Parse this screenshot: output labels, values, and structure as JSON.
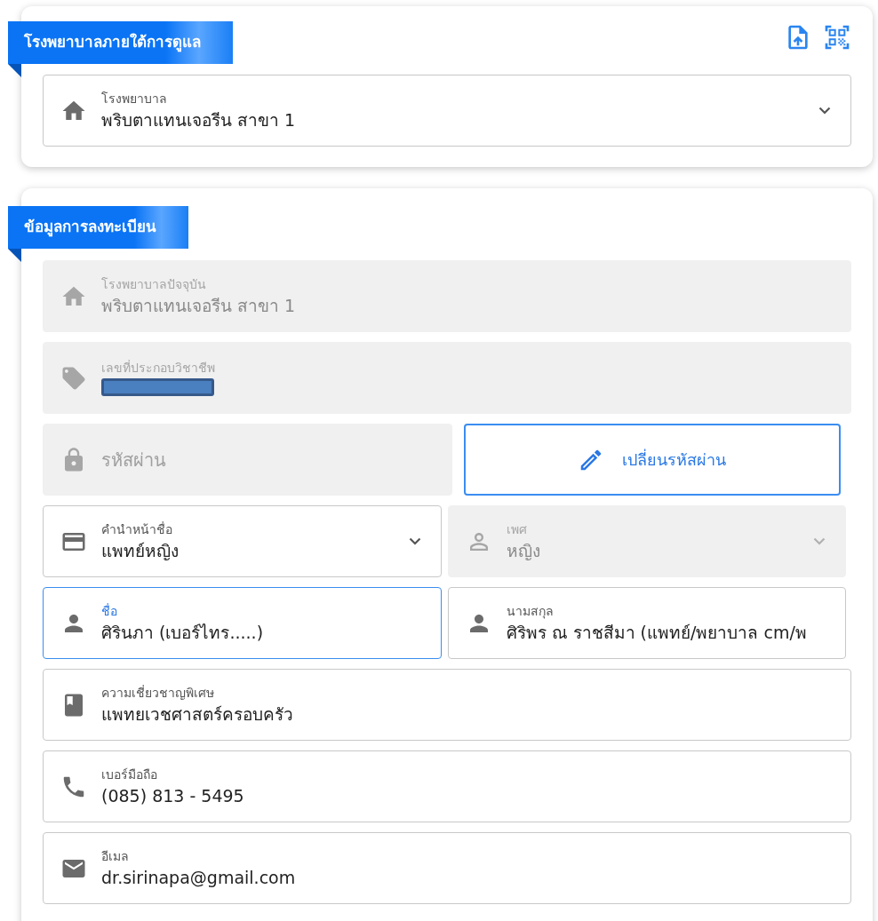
{
  "hospital_card": {
    "title": "โรงพยาบาลภายใต้การดูแล",
    "field": {
      "kind": "field",
      "label": "โรงพยาบาล",
      "value": "พริบตาแทนเจอรีน สาขา 1",
      "disabled": false,
      "focused": false,
      "dropdown": true
    }
  },
  "registration_card": {
    "title": "ข้อมูลการลงทะเบียน",
    "rows": [
      [
        {
          "kind": "field",
          "label": "โรงพยาบาลปัจจุบัน",
          "value": "พริบตาแทนเจอรีน สาขา 1",
          "disabled": true,
          "focused": false,
          "dropdown": false
        }
      ],
      [
        {
          "kind": "field",
          "label": "เลขที่ประกอบวิชาชีพ",
          "redacted": true,
          "disabled": true,
          "focused": false,
          "dropdown": false
        }
      ],
      [
        {
          "kind": "placeholder_field",
          "placeholder": "รหัสผ่าน",
          "disabled": true
        },
        {
          "kind": "button",
          "label": "เปลี่ยนรหัสผ่าน"
        }
      ],
      [
        {
          "kind": "field",
          "label": "คำนำหน้าชื่อ",
          "value": "แพทย์หญิง",
          "disabled": false,
          "focused": false,
          "dropdown": true
        },
        {
          "kind": "field",
          "label": "เพศ",
          "value": "หญิง",
          "disabled": true,
          "focused": false,
          "dropdown": true
        }
      ],
      [
        {
          "kind": "field",
          "label": "ชื่อ",
          "value": "ศิรินภา (เบอร์ไทร.....)",
          "disabled": false,
          "focused": true,
          "dropdown": false
        },
        {
          "kind": "field",
          "label": "นามสกุล",
          "value": "ศิริพร ณ ราชสีมา (แพทย์/พยาบาล cm/พ",
          "disabled": false,
          "focused": false,
          "dropdown": false
        }
      ],
      [
        {
          "kind": "field",
          "label": "ความเชี่ยวชาญพิเศษ",
          "value": "แพทยเวชศาสตร์ครอบครัว",
          "disabled": false,
          "focused": false,
          "dropdown": false
        }
      ],
      [
        {
          "kind": "field",
          "label": "เบอร์มือถือ",
          "value": "(085) 813 - 5495",
          "disabled": false,
          "focused": false,
          "dropdown": false
        }
      ],
      [
        {
          "kind": "field",
          "label": "อีเมล",
          "value": "dr.sirinapa@gmail.com",
          "disabled": false,
          "focused": false,
          "dropdown": false
        }
      ]
    ]
  }
}
